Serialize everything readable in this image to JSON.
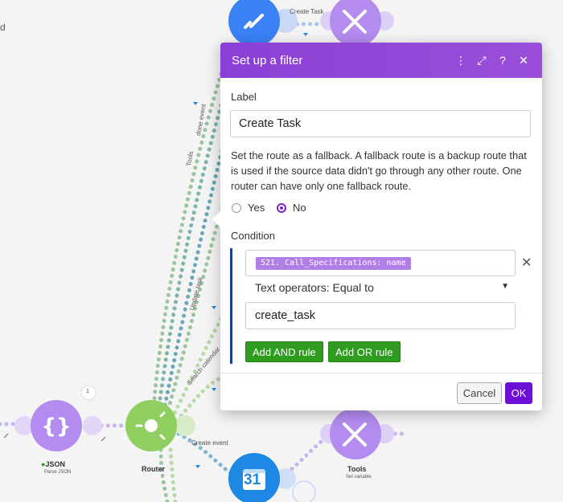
{
  "canvas": {
    "partial_text": "d",
    "modules": {
      "json": {
        "name": "JSON",
        "subtitle": "Parse JSON",
        "color": "#b48cf0",
        "icon": "braces-icon"
      },
      "router": {
        "name": "Router",
        "color": "#8ecf60",
        "icon": "router-icon"
      },
      "tools_top": {
        "color": "#b48cf0",
        "icon": "tools-icon"
      },
      "tools_bottom": {
        "name": "Tools",
        "subtitle": "Set variable",
        "color": "#b48cf0",
        "icon": "tools-icon"
      },
      "calendar": {
        "label": "31",
        "color": "#1e88e5",
        "icon": "google-calendar-icon"
      },
      "task_top": {
        "color": "#3b82f6",
        "icon": "check-icon"
      }
    },
    "link_labels": {
      "create_task": "Create Task",
      "create_event": "Create event",
      "tools": "Tools",
      "update_task": "Update task",
      "search_calendar": "Search calendar",
      "done_event": "done event"
    },
    "badge_count": "1"
  },
  "modal": {
    "title": "Set up a filter",
    "label_field_label": "Label",
    "label_value": "Create Task",
    "fallback_text": "Set the route as a fallback. A fallback route is a backup route that is used if the source data didn't go through any other route. One router can have only one fallback route.",
    "radio_yes": "Yes",
    "radio_no": "No",
    "condition_label": "Condition",
    "condition_expression": "521. Call_Specifications: name",
    "operator": "Text operators: Equal to",
    "value": "create_task",
    "add_and_label": "Add AND rule",
    "add_or_label": "Add OR rule",
    "cancel_label": "Cancel",
    "ok_label": "OK",
    "header_icons": [
      "more-vertical-icon",
      "expand-icon",
      "help-icon",
      "close-icon"
    ]
  },
  "colors": {
    "header": "#8b3fd6",
    "primary": "#6d0fd6",
    "green": "#2e9d1f",
    "condition_bar": "#1c3f9c"
  }
}
